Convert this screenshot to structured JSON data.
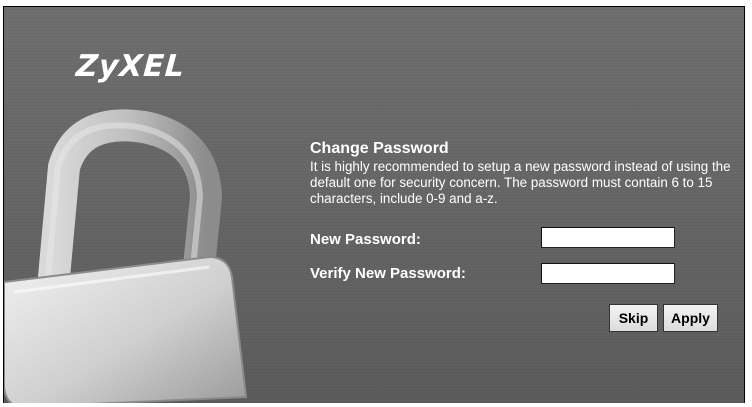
{
  "brand": {
    "logo_text": "ZyXEL"
  },
  "form": {
    "title": "Change Password",
    "description": "It is highly recommended to setup a new password instead of using the default one for security concern. The password must contain 6 to 15 characters, include 0-9 and a-z.",
    "new_password_label": "New Password:",
    "new_password_value": "",
    "verify_password_label": "Verify New Password:",
    "verify_password_value": "",
    "skip_label": "Skip",
    "apply_label": "Apply"
  },
  "icons": {
    "lock": "padlock-icon"
  },
  "colors": {
    "panel_bg": "#666666",
    "text": "#ffffff"
  }
}
